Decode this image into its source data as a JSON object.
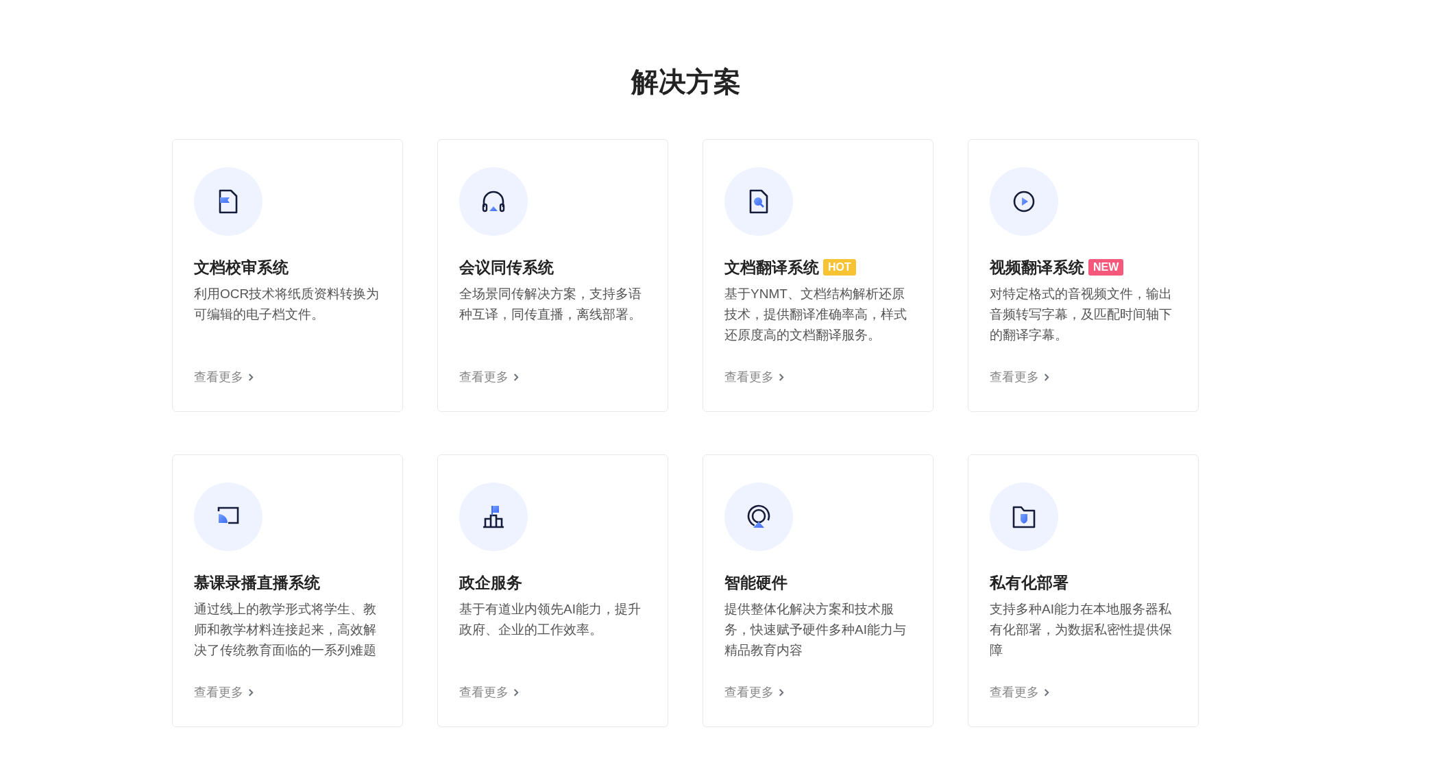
{
  "heading": "解决方案",
  "cards": [
    {
      "kind": "document",
      "title": "文档校审系统",
      "description": "利用OCR技术将纸质资料转换为可编辑的电子档文件。",
      "link": "查看更多"
    },
    {
      "kind": "headphones",
      "title": "会议同传系统",
      "description": "全场景同传解决方案，支持多语种互译，同传直播，离线部署。",
      "link": "查看更多"
    },
    {
      "kind": "search-document",
      "title": "文档翻译系统",
      "badge": {
        "text": "HOT",
        "color": "#f8c332"
      },
      "description": "基于YNMT、文档结构解析还原技术，提供翻译准确率高，样式还原度高的文档翻译服务。",
      "link": "查看更多"
    },
    {
      "kind": "play",
      "title": "视频翻译系统",
      "badge": {
        "text": "NEW",
        "color": "#f5587b"
      },
      "description": "对特定格式的音视频文件，输出音频转写字幕，及匹配时间轴下的翻译字幕。",
      "link": "查看更多"
    },
    {
      "kind": "cast",
      "title": "慕课录播直播系统",
      "description": "通过线上的教学形式将学生、教师和教学材料连接起来，高效解决了传统教育面临的一系列难题",
      "link": "查看更多"
    },
    {
      "kind": "buildings",
      "title": "政企服务",
      "description": "基于有道业内领先AI能力，提升政府、企业的工作效率。",
      "link": "查看更多"
    },
    {
      "kind": "broadcast",
      "title": "智能硬件",
      "description": "提供整体化解决方案和技术服务，快速赋予硬件多种AI能力与精品教育内容",
      "link": "查看更多"
    },
    {
      "kind": "folder",
      "title": "私有化部署",
      "description": "支持多种AI能力在本地服务器私有化部署，为数据私密性提供保障",
      "link": "查看更多"
    }
  ]
}
